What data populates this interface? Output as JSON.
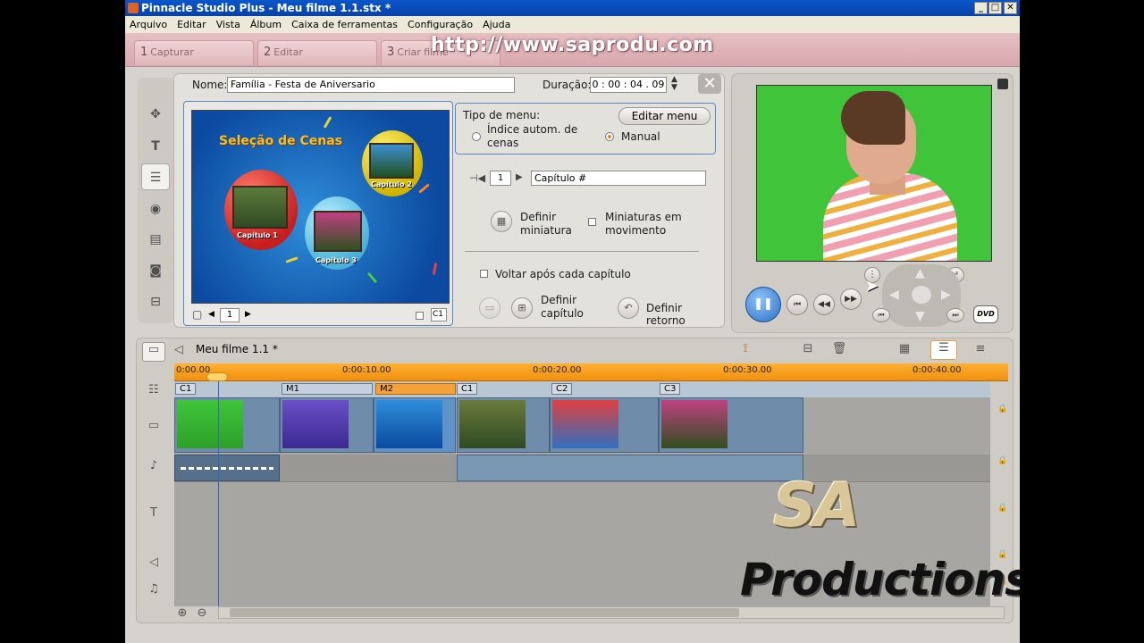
{
  "window": {
    "title": "Pinnacle Studio Plus - Meu filme 1.1.stx *"
  },
  "menu": [
    "Arquivo",
    "Editar",
    "Vista",
    "Álbum",
    "Caixa de ferramentas",
    "Configuração",
    "Ajuda"
  ],
  "mode_tabs": [
    {
      "num": "1",
      "label": "Capturar"
    },
    {
      "num": "2",
      "label": "Editar"
    },
    {
      "num": "3",
      "label": "Criar filme"
    }
  ],
  "watermark_url": "http://www.saprodu.com",
  "editor": {
    "name_label": "Nome:",
    "name_value": "Família - Festa de Aniversario",
    "duration_label": "Duração:",
    "duration_value": "0 : 00 : 04 . 09",
    "menu_preview": {
      "title": "Seleção de Cenas",
      "chapters": [
        "Capítulo 1",
        "Capítulo 2",
        "Capítulo 3"
      ],
      "page_value": "1",
      "chapter_marker": "C1"
    },
    "menu_type_label": "Tipo de menu:",
    "auto_index_label": "Índice autom. de cenas",
    "manual_label": "Manual",
    "manual_selected": true,
    "edit_menu_button": "Editar menu",
    "chapter_number": "1",
    "chapter_name_value": "Capítulo #",
    "set_thumb_label": "Definir miniatura",
    "motion_thumbs_label": "Miniaturas em movimento",
    "return_after_label": "Voltar após cada capítulo",
    "set_chapter_label": "Definir capítulo",
    "set_return_label": "Definir retorno"
  },
  "player": {
    "dvd_label": "DVD"
  },
  "timeline": {
    "project_title": "Meu filme 1.1 *",
    "ruler_ticks": [
      "0:00.00",
      "0:00:10.00",
      "0:00:20.00",
      "0:00:30.00",
      "0:00:40.00"
    ],
    "chapter_tags": [
      "C1",
      "M1",
      "M2",
      "C1",
      "C2",
      "C3"
    ]
  },
  "overlay": {
    "logo_big": "SA",
    "logo_sub": "Productions"
  },
  "colors": {
    "title_bar": "#0a56c9",
    "ruler": "#f09010",
    "video_bg": "#3fc43a",
    "clip": "#6f8cab"
  }
}
